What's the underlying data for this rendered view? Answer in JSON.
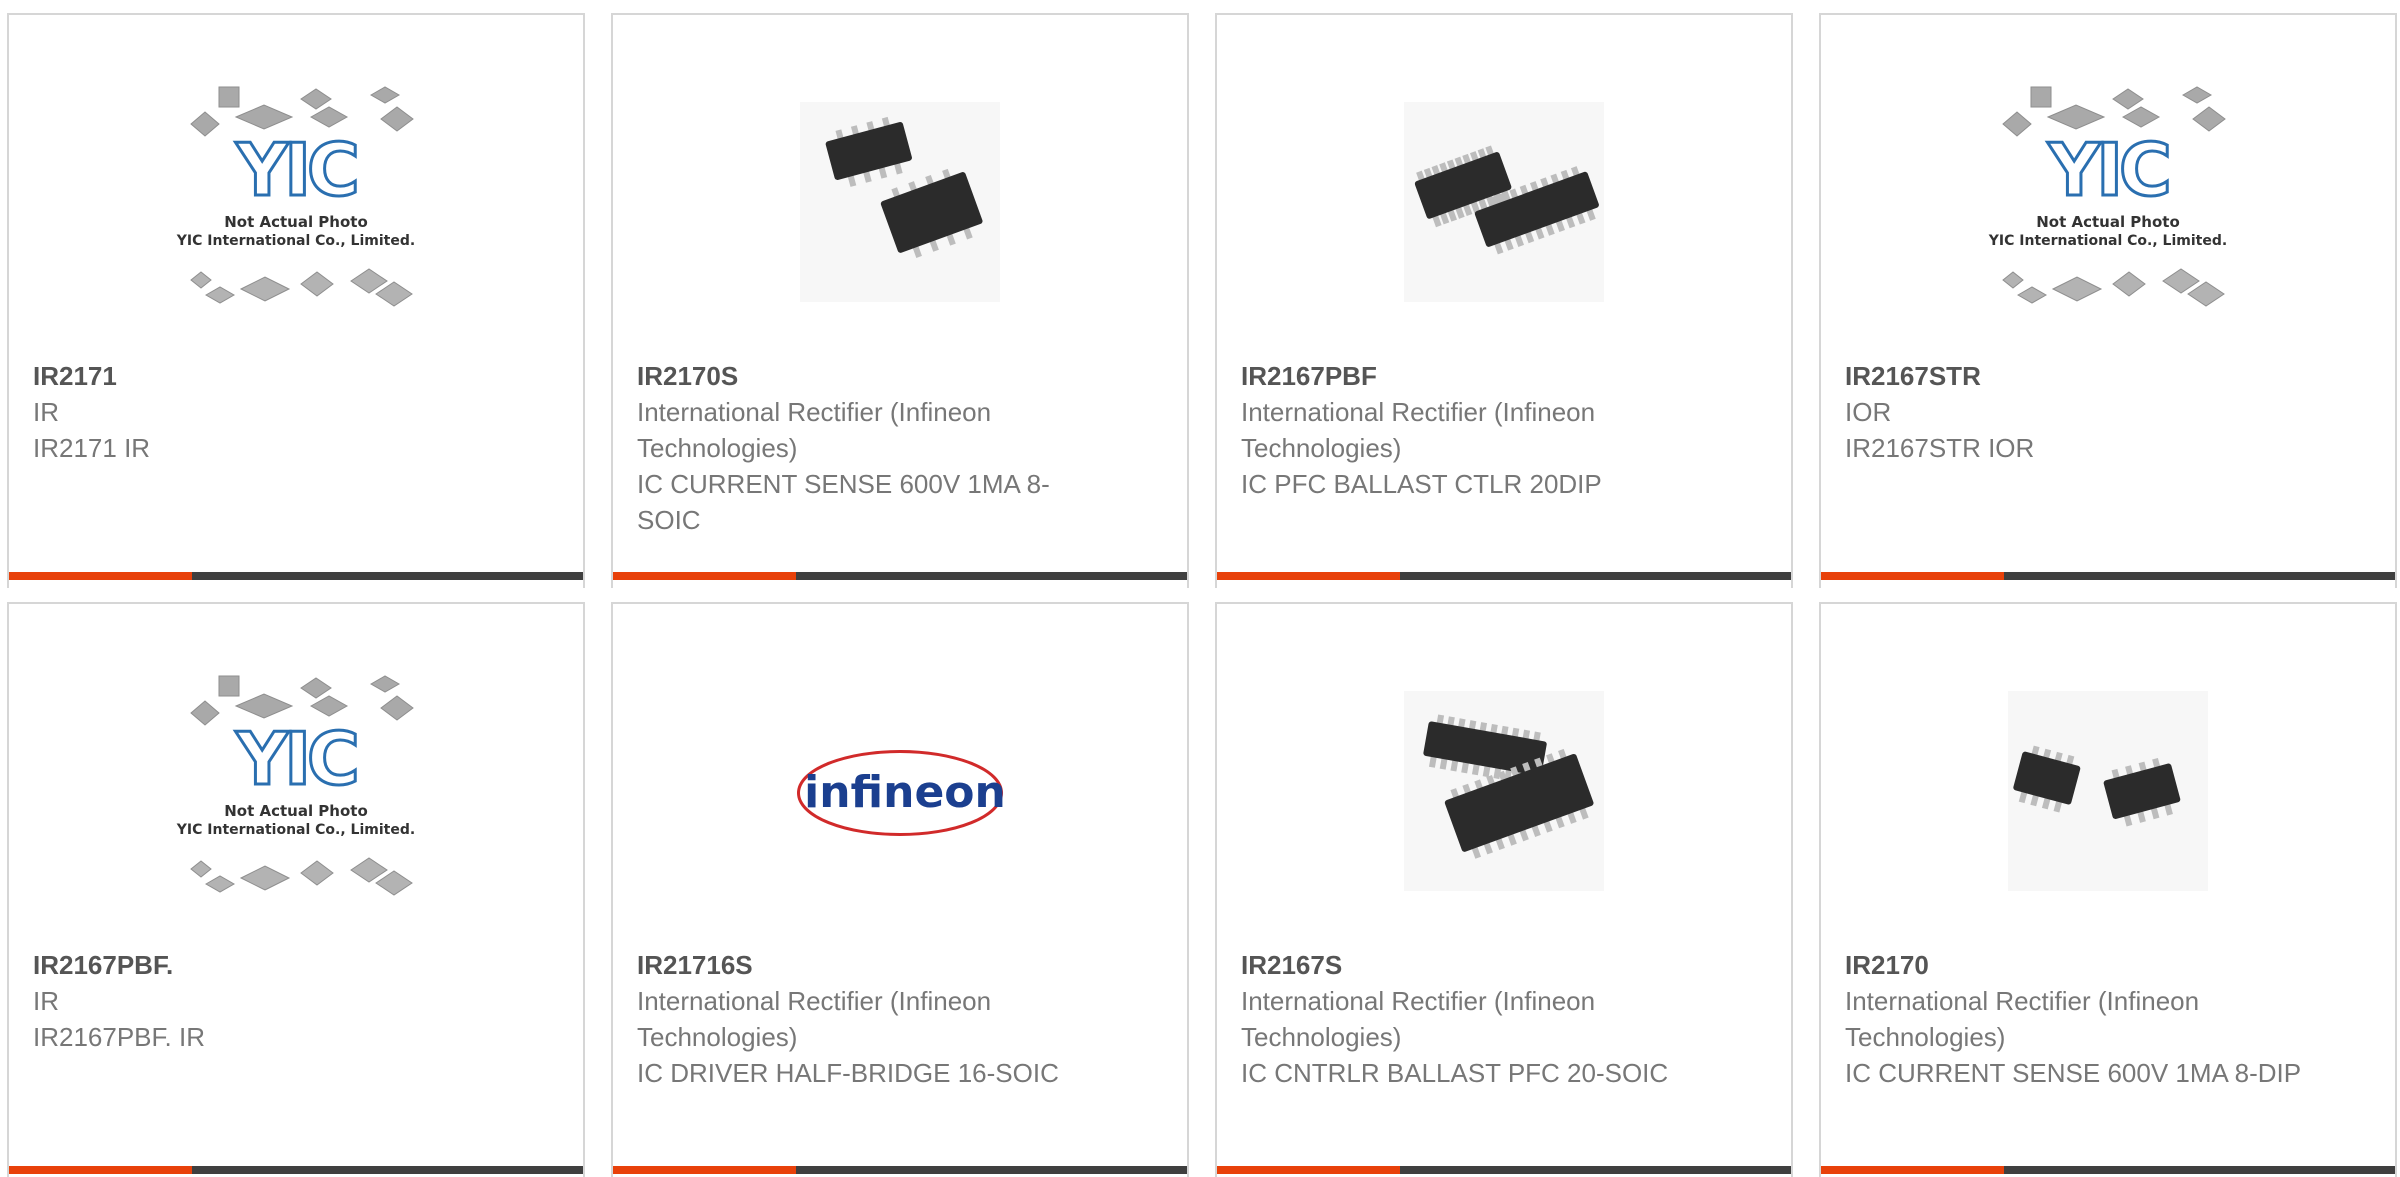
{
  "colors": {
    "accent": "#e8410a",
    "bar_dark": "#3f3f3f",
    "title_text": "#555555",
    "body_text": "#777777",
    "border": "#d6d6d6"
  },
  "placeholder": {
    "line1": "Not Actual Photo",
    "line2": "YIC International Co., Limited.",
    "logo": "YIC"
  },
  "infineon_logo": "infineon",
  "products": [
    {
      "part": "IR2171",
      "manufacturer": "IR",
      "description": "IR2171 IR",
      "image": "yic-placeholder-image"
    },
    {
      "part": "IR2170S",
      "manufacturer": "International Rectifier (Infineon Technologies)",
      "description": "IC CURRENT SENSE 600V 1MA 8-SOIC",
      "image": "soic8-chip-image"
    },
    {
      "part": "IR2167PBF",
      "manufacturer": "International Rectifier (Infineon Technologies)",
      "description": "IC PFC BALLAST CTLR 20DIP",
      "image": "dip20-chip-image"
    },
    {
      "part": "IR2167STR",
      "manufacturer": "IOR",
      "description": "IR2167STR IOR",
      "image": "yic-placeholder-image"
    },
    {
      "part": "IR2167PBF.",
      "manufacturer": "IR",
      "description": "IR2167PBF. IR",
      "image": "yic-placeholder-image"
    },
    {
      "part": "IR21716S",
      "manufacturer": "International Rectifier (Infineon Technologies)",
      "description": "IC DRIVER HALF-BRIDGE 16-SOIC",
      "image": "infineon-logo-image"
    },
    {
      "part": "IR2167S",
      "manufacturer": "International Rectifier (Infineon Technologies)",
      "description": "IC CNTRLR BALLAST PFC 20-SOIC",
      "image": "soic20-chip-image"
    },
    {
      "part": "IR2170",
      "manufacturer": "International Rectifier (Infineon Technologies)",
      "description": "IC CURRENT SENSE 600V 1MA 8-DIP",
      "image": "dip8-chip-image"
    }
  ]
}
